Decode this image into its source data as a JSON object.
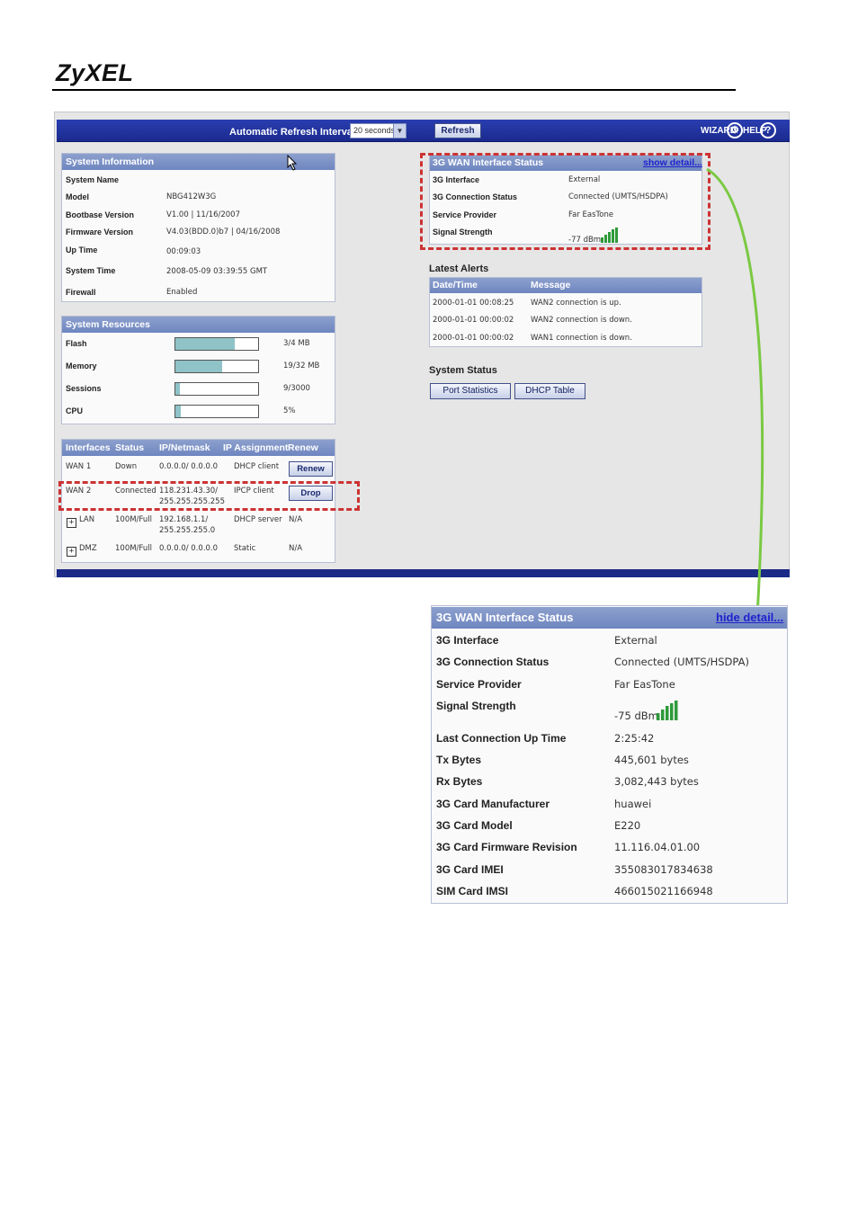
{
  "brand": {
    "logo": "ZyXEL"
  },
  "toolbar": {
    "refresh_interval_label": "Automatic Refresh Interval",
    "refresh_interval_value": "20 seconds",
    "refresh_button": "Refresh",
    "wizard_label": "WIZARD",
    "help_label": "HELP"
  },
  "system_information": {
    "title": "System Information",
    "rows": [
      {
        "label": "System Name",
        "value": ""
      },
      {
        "label": "Model",
        "value": "NBG412W3G"
      },
      {
        "label": "Bootbase Version",
        "value": "V1.00 | 11/16/2007"
      },
      {
        "label": "Firmware Version",
        "value": "V4.03(BDD.0)b7 | 04/16/2008"
      },
      {
        "label": "Up Time",
        "value": "00:09:03"
      },
      {
        "label": "System Time",
        "value": "2008-05-09 03:39:55 GMT"
      },
      {
        "label": "Firewall",
        "value": "Enabled"
      }
    ]
  },
  "system_resources": {
    "title": "System Resources",
    "rows": [
      {
        "label": "Flash",
        "value": "3/4 MB",
        "fraction": 0.75
      },
      {
        "label": "Memory",
        "value": "19/32 MB",
        "fraction": 0.59
      },
      {
        "label": "Sessions",
        "value": "9/3000",
        "fraction": 0.003
      },
      {
        "label": "CPU",
        "value": "5%",
        "fraction": 0.05
      }
    ]
  },
  "interfaces": {
    "headers": [
      "Interfaces",
      "Status",
      "IP/Netmask",
      "IP Assignment",
      "Renew"
    ],
    "rows": [
      {
        "name": "WAN 1",
        "status": "Down",
        "ip": "0.0.0.0/ 0.0.0.0",
        "ip2": "",
        "assign": "DHCP client",
        "renew": "Renew"
      },
      {
        "name": "WAN 2",
        "status": "Connected",
        "ip": "118.231.43.30/",
        "ip2": "255.255.255.255",
        "assign": "IPCP client",
        "renew": "Drop"
      },
      {
        "name": "LAN",
        "status": "100M/Full",
        "ip": "192.168.1.1/",
        "ip2": "255.255.255.0",
        "assign": "DHCP server",
        "renew": "N/A"
      },
      {
        "name": "DMZ",
        "status": "100M/Full",
        "ip": "0.0.0.0/ 0.0.0.0",
        "ip2": "",
        "assign": "Static",
        "renew": "N/A"
      }
    ]
  },
  "wan3g_small": {
    "title": "3G WAN Interface Status",
    "link": "show detail...",
    "rows": [
      {
        "label": "3G Interface",
        "value": "External"
      },
      {
        "label": "3G Connection Status",
        "value": "Connected (UMTS/HSDPA)"
      },
      {
        "label": "Service Provider",
        "value": "Far EasTone"
      },
      {
        "label": "Signal Strength",
        "value": "-77 dBm"
      }
    ]
  },
  "latest_alerts": {
    "title": "Latest Alerts",
    "headers": [
      "Date/Time",
      "Message"
    ],
    "rows": [
      {
        "time": "2000-01-01 00:08:25",
        "message": "WAN2 connection is up."
      },
      {
        "time": "2000-01-01 00:00:02",
        "message": "WAN2 connection is down."
      },
      {
        "time": "2000-01-01 00:00:02",
        "message": "WAN1 connection is down."
      }
    ]
  },
  "system_status": {
    "title": "System Status",
    "port_statistics": "Port Statistics",
    "dhcp_table": "DHCP Table"
  },
  "wan3g_detail": {
    "title": "3G WAN Interface Status",
    "link": "hide detail...",
    "rows": [
      {
        "label": "3G Interface",
        "value": "External"
      },
      {
        "label": "3G Connection Status",
        "value": "Connected (UMTS/HSDPA)"
      },
      {
        "label": "Service Provider",
        "value": "Far EasTone"
      },
      {
        "label": "Signal Strength",
        "value": "-75 dBm"
      },
      {
        "label": "Last Connection Up Time",
        "value": "2:25:42"
      },
      {
        "label": "Tx Bytes",
        "value": "445,601 bytes"
      },
      {
        "label": "Rx Bytes",
        "value": "3,082,443 bytes"
      },
      {
        "label": "3G Card Manufacturer",
        "value": "huawei"
      },
      {
        "label": "3G Card Model",
        "value": "E220"
      },
      {
        "label": "3G Card Firmware Revision",
        "value": "11.116.04.01.00"
      },
      {
        "label": "3G Card IMEI",
        "value": "355083017834638"
      },
      {
        "label": "SIM Card IMSI",
        "value": "466015021166948"
      }
    ]
  },
  "colors": {
    "accent": "#1a2a8e",
    "header": "#7a8fc6",
    "callout": "#cc3333",
    "arrow": "#7ac943"
  }
}
